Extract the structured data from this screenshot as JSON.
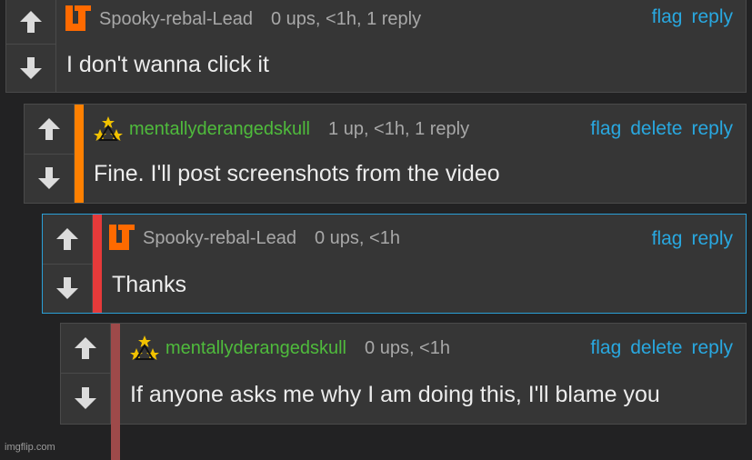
{
  "comments": [
    {
      "username": "Spooky-rebal-Lead",
      "meta": "0 ups, <1h, 1 reply",
      "actions": [
        "flag",
        "reply"
      ],
      "text": "I don't wanna click it",
      "accent_color": "#ff6a00"
    },
    {
      "username": "mentallyderangedskull",
      "meta": "1 up, <1h, 1 reply",
      "actions": [
        "flag",
        "delete",
        "reply"
      ],
      "text": "Fine. I'll post screenshots from the video",
      "accent_color": "#ff8000"
    },
    {
      "username": "Spooky-rebal-Lead",
      "meta": "0 ups, <1h",
      "actions": [
        "flag",
        "reply"
      ],
      "text": "Thanks",
      "accent_color": "#e63a3a"
    },
    {
      "username": "mentallyderangedskull",
      "meta": "0 ups, <1h",
      "actions": [
        "flag",
        "delete",
        "reply"
      ],
      "text": "If anyone asks me why I am doing this, I'll blame you",
      "accent_color": "#9e4a4a"
    }
  ],
  "watermark": "imgflip.com"
}
